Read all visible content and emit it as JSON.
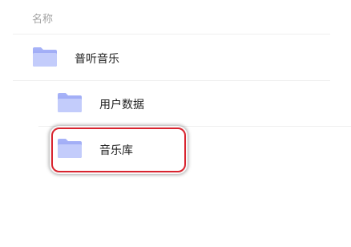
{
  "header": {
    "name_column": "名称"
  },
  "folders": [
    {
      "label": "普听音乐",
      "icon": "folder-icon",
      "level": 0
    },
    {
      "label": "用户数据",
      "icon": "folder-icon",
      "level": 1
    },
    {
      "label": "音乐库",
      "icon": "folder-icon",
      "level": 1,
      "highlighted": true
    }
  ],
  "colors": {
    "folder_light": "#c4cdfb",
    "folder_dark": "#8f9cf2",
    "highlight_border": "#d9242f",
    "header_text": "#a3a3a3"
  }
}
